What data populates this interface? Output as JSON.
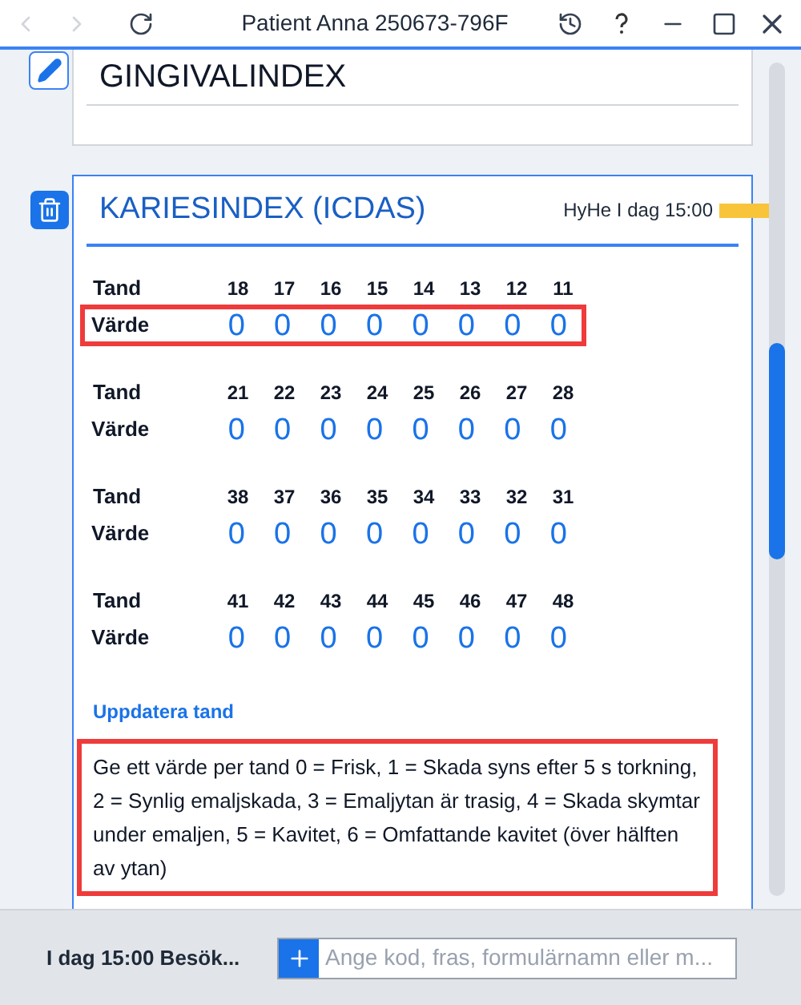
{
  "window": {
    "title": "Patient Anna 250673-796F"
  },
  "gingival": {
    "title": "GINGIVALINDEX"
  },
  "caries": {
    "title": "KARIESINDEX (ICDAS)",
    "signature": "HyHe I dag 15:00",
    "groups": [
      {
        "row_label_tooth": "Tand",
        "row_label_value": "Värde",
        "highlighted": true,
        "teeth": [
          {
            "number": "18",
            "value": "0"
          },
          {
            "number": "17",
            "value": "0"
          },
          {
            "number": "16",
            "value": "0"
          },
          {
            "number": "15",
            "value": "0"
          },
          {
            "number": "14",
            "value": "0"
          },
          {
            "number": "13",
            "value": "0"
          },
          {
            "number": "12",
            "value": "0"
          },
          {
            "number": "11",
            "value": "0"
          }
        ]
      },
      {
        "row_label_tooth": "Tand",
        "row_label_value": "Värde",
        "highlighted": false,
        "teeth": [
          {
            "number": "21",
            "value": "0"
          },
          {
            "number": "22",
            "value": "0"
          },
          {
            "number": "23",
            "value": "0"
          },
          {
            "number": "24",
            "value": "0"
          },
          {
            "number": "25",
            "value": "0"
          },
          {
            "number": "26",
            "value": "0"
          },
          {
            "number": "27",
            "value": "0"
          },
          {
            "number": "28",
            "value": "0"
          }
        ]
      },
      {
        "row_label_tooth": "Tand",
        "row_label_value": "Värde",
        "highlighted": false,
        "teeth": [
          {
            "number": "38",
            "value": "0"
          },
          {
            "number": "37",
            "value": "0"
          },
          {
            "number": "36",
            "value": "0"
          },
          {
            "number": "35",
            "value": "0"
          },
          {
            "number": "34",
            "value": "0"
          },
          {
            "number": "33",
            "value": "0"
          },
          {
            "number": "32",
            "value": "0"
          },
          {
            "number": "31",
            "value": "0"
          }
        ]
      },
      {
        "row_label_tooth": "Tand",
        "row_label_value": "Värde",
        "highlighted": false,
        "teeth": [
          {
            "number": "41",
            "value": "0"
          },
          {
            "number": "42",
            "value": "0"
          },
          {
            "number": "43",
            "value": "0"
          },
          {
            "number": "44",
            "value": "0"
          },
          {
            "number": "45",
            "value": "0"
          },
          {
            "number": "46",
            "value": "0"
          },
          {
            "number": "47",
            "value": "0"
          },
          {
            "number": "48",
            "value": "0"
          }
        ]
      }
    ],
    "update_link": "Uppdatera tand",
    "instructions": {
      "text": "Ge ett värde per tand 0 = Frisk, 1 = Skada syns efter 5 s torkning, 2 = Synlig emaljskada, 3 = Emaljytan är trasig, 4 = Skada skymtar under emaljen, 5 = Kavitet, 6 = Omfattande kavitet (över hälften av ytan)",
      "highlighted": true
    }
  },
  "footer": {
    "visit": "I dag 15:00 Besök...",
    "search": {
      "placeholder": "Ange kod, fras, formulärnamn eller m..."
    }
  }
}
